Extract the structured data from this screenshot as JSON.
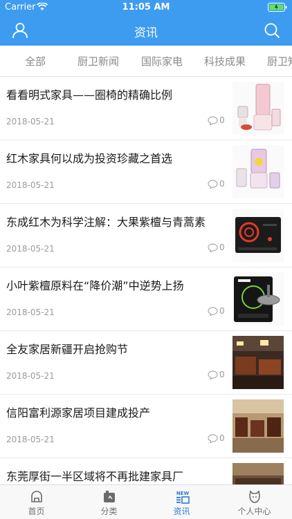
{
  "status": {
    "carrier": "Carrier",
    "time": "11:05 AM"
  },
  "nav": {
    "title": "资讯",
    "left_icon": "user-icon",
    "right_icon": "search-icon"
  },
  "tabs": [
    {
      "label": "全部"
    },
    {
      "label": "厨卫新闻"
    },
    {
      "label": "国际家电"
    },
    {
      "label": "科技成果"
    },
    {
      "label": "厨卫知"
    }
  ],
  "articles": [
    {
      "title": "看看明式家具——圈椅的精确比例",
      "date": "2018-05-21",
      "comments": "0",
      "thumb": "blender-set"
    },
    {
      "title": "红木家具何以成为投资珍藏之首选",
      "date": "2018-05-21",
      "comments": "0",
      "thumb": "juicer-set"
    },
    {
      "title": "东成红木为科学注解：大果紫檀与青蒿素",
      "date": "2018-05-21",
      "comments": "0",
      "thumb": "induction-cooker"
    },
    {
      "title": "小叶紫檀原料在“降价潮”中逆势上扬",
      "date": "2018-05-21",
      "comments": "0",
      "thumb": "supor-cooker"
    },
    {
      "title": "全友家居新疆开启抢购节",
      "date": "2018-05-21",
      "comments": "0",
      "thumb": "furniture-showroom"
    },
    {
      "title": "信阳富利源家居项目建成投产",
      "date": "2018-05-21",
      "comments": "0",
      "thumb": "furniture-hall"
    },
    {
      "title": "东莞厚街一半区域将不再批建家具厂",
      "date": "",
      "comments": "",
      "thumb": "furniture-hall-2"
    }
  ],
  "bottom_tabs": [
    {
      "label": "首页",
      "icon": "home-icon"
    },
    {
      "label": "分类",
      "icon": "category-icon"
    },
    {
      "label": "资讯",
      "icon": "news-icon",
      "badge": "NEW",
      "active": true
    },
    {
      "label": "个人中心",
      "icon": "profile-icon"
    }
  ],
  "colors": {
    "accent": "#3d9cf0",
    "active_tab": "#2a7bd6"
  }
}
